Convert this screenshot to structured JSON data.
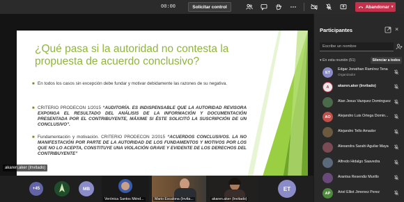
{
  "toolbar": {
    "timer": "00:00",
    "control_label": "Solicitar control",
    "leave_label": "Abandonar",
    "leave_color": "#c4314b",
    "icons": [
      "people-icon",
      "chat-icon",
      "raise-hand-icon",
      "more-icon",
      "camera-off-icon",
      "mic-off-icon",
      "share-icon"
    ]
  },
  "slide": {
    "title": "¿Qué pasa si la autoridad no contesta la propuesta de acuerdo conclusivo?",
    "title_color": "#8fb53c",
    "bullet1": "En todos los casos sin excepción debe fundar y motivar debidamente las razones de su negativa.",
    "bullet2_lead": "CRITERIO PRODECON 1/2015 ",
    "bullet2_em": "“AUDITORÍA. ES INDISPENSABLE QUE LA AUTORIDAD REVISORA EXPONGA EL RESULTADO DEL ANÁLISIS DE LA INFORMACIÓN Y DOCUMENTACIÓN PRESENTADA POR EL CONTRIBUYENTE, MÁXIME SI ÉSTE SOLICITÓ LA SUSCRIPCIÓN DE UN CONCLUSIVO”.",
    "bullet3_lead": "Fundamentación y motivación. CRITERIO PRODECON 2/2015 ",
    "bullet3_em": "“ACUERDOS CONCLUSIVOS. LA NO MANIFESTACIÓN POR PARTE DE LA AUTORIDAD DE LOS FUNDAMENTOS Y MOTIVOS POR LOS QUE NO LO ACEPTA, CONSTITUYE UNA VIOLACIÓN GRAVE Y EVIDENTE DE LOS DERECHOS DEL CONTRIBUYENTE”"
  },
  "presenter_label": "akaren.aker (Invitado)",
  "panel": {
    "title": "Participantes",
    "search_placeholder": "Escribe un nombre",
    "section_label": "En esta reunión (51)",
    "mute_all_label": "Silenciar a todos",
    "participants": [
      {
        "initials": "ET",
        "name": "Edgar Jonathan Ramírez Tena",
        "role": "Organizador",
        "color": "#8b8cc7"
      },
      {
        "initials": "",
        "name": "akaren.aker (Invitado)",
        "role": "",
        "color": "#e8e8e8"
      },
      {
        "initials": "",
        "name": "Alan Jesus Vazquez Dominguez",
        "role": "",
        "color": "#4a6b4a"
      },
      {
        "initials": "AO",
        "name": "Alejandro Luis Ortega Domin...",
        "role": "",
        "color": "#c1504b"
      },
      {
        "initials": "",
        "name": "Alejandro Tello Amador",
        "role": "",
        "color": "#6b5a3e"
      },
      {
        "initials": "",
        "name": "Alexandra Sarahi Aguilar Maya",
        "role": "",
        "color": "#7a4a55"
      },
      {
        "initials": "",
        "name": "Alfredo Hidalgo Saavedra",
        "role": "",
        "color": "#5a6a7a"
      },
      {
        "initials": "",
        "name": "Arantxa Resendiz Murillo",
        "role": "",
        "color": "#6a4a7a"
      },
      {
        "initials": "AP",
        "name": "Ariel Elliot Jimenez Perez",
        "role": "",
        "color": "#4f8a3f"
      }
    ]
  },
  "bottom": {
    "overflow_count": "+45",
    "initials_mb": "MB",
    "initials_et": "ET",
    "tile_names": [
      "Verónica Santos Ménd...",
      "Mario Escalona (Invita...",
      "akaren.aker (Invitado)"
    ]
  }
}
